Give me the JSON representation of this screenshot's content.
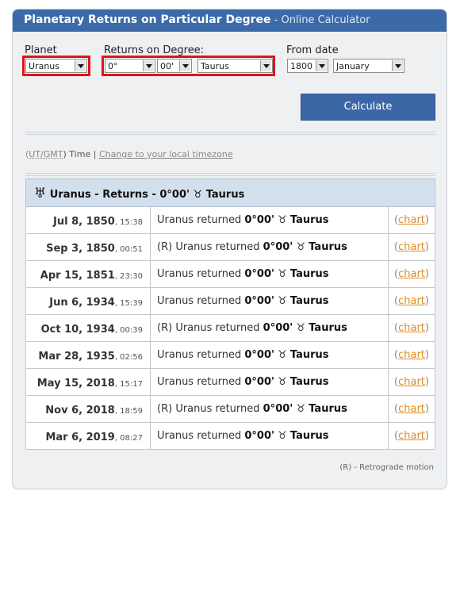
{
  "header": {
    "title": "Planetary Returns on Particular Degree",
    "subtitle": " - Online Calculator"
  },
  "form": {
    "planet_label": "Planet",
    "planet_value": "Uranus",
    "returns_label": "Returns on Degree:",
    "degree_value": "0°",
    "minute_value": "00'",
    "sign_value": "Taurus",
    "from_label": "From date",
    "year_value": "1800",
    "month_value": "January",
    "calculate_label": "Calculate"
  },
  "timezone": {
    "open_paren": "(",
    "ut": "UT/GMT",
    "close": ") Time |",
    "change_link": "Change to your local timezone"
  },
  "results": {
    "header_icon": "uranus-symbol-icon",
    "header_text": "Uranus - Returns - 0°00'",
    "header_sign_icon": "taurus-symbol-icon",
    "header_sign": "Taurus",
    "sign_glyph": "♉",
    "planet_glyph": "♅",
    "rows": [
      {
        "date": "Jul 8, 1850",
        "time": ", 15:38",
        "retro": "",
        "text": "Uranus returned",
        "deg": "0°00'",
        "sign": "Taurus",
        "link": "chart"
      },
      {
        "date": "Sep 3, 1850",
        "time": ", 00:51",
        "retro": "(R) ",
        "text": "Uranus returned",
        "deg": "0°00'",
        "sign": "Taurus",
        "link": "chart"
      },
      {
        "date": "Apr 15, 1851",
        "time": ", 23:30",
        "retro": "",
        "text": "Uranus returned",
        "deg": "0°00'",
        "sign": "Taurus",
        "link": "chart"
      },
      {
        "date": "Jun 6, 1934",
        "time": ", 15:39",
        "retro": "",
        "text": "Uranus returned",
        "deg": "0°00'",
        "sign": "Taurus",
        "link": "chart"
      },
      {
        "date": "Oct 10, 1934",
        "time": ", 00:39",
        "retro": "(R) ",
        "text": "Uranus returned",
        "deg": "0°00'",
        "sign": "Taurus",
        "link": "chart"
      },
      {
        "date": "Mar 28, 1935",
        "time": ", 02:56",
        "retro": "",
        "text": "Uranus returned",
        "deg": "0°00'",
        "sign": "Taurus",
        "link": "chart"
      },
      {
        "date": "May 15, 2018",
        "time": ", 15:17",
        "retro": "",
        "text": "Uranus returned",
        "deg": "0°00'",
        "sign": "Taurus",
        "link": "chart"
      },
      {
        "date": "Nov 6, 2018",
        "time": ", 18:59",
        "retro": "(R) ",
        "text": "Uranus returned",
        "deg": "0°00'",
        "sign": "Taurus",
        "link": "chart"
      },
      {
        "date": "Mar 6, 2019",
        "time": ", 08:27",
        "retro": "",
        "text": "Uranus returned",
        "deg": "0°00'",
        "sign": "Taurus",
        "link": "chart"
      }
    ],
    "footnote": "(R) - Retrograde motion"
  },
  "colors": {
    "title_bar": "#3c6aa8",
    "highlight_box": "#e0141b",
    "link": "#e08a1e",
    "table_header": "#d4dfee"
  }
}
